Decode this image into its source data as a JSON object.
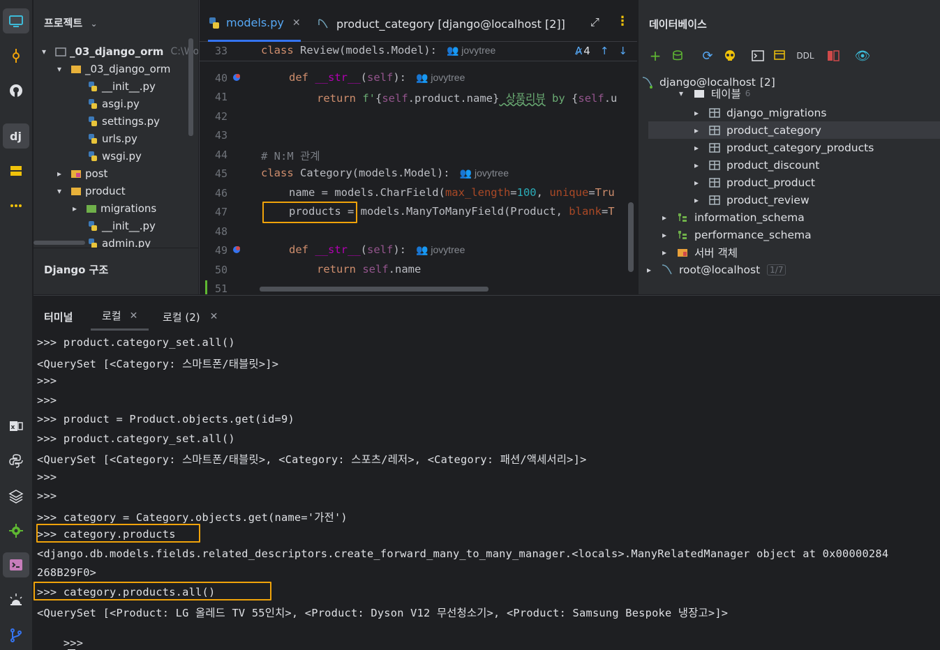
{
  "project_panel": {
    "title": "프로젝트",
    "tree": [
      {
        "label": "_03_django_orm",
        "suffix": "C:\\Wo",
        "type": "root-folder",
        "expanded": true
      },
      {
        "label": "_03_django_orm",
        "type": "package",
        "expanded": true
      },
      {
        "label": "__init__.py",
        "type": "python"
      },
      {
        "label": "asgi.py",
        "type": "python"
      },
      {
        "label": "settings.py",
        "type": "python"
      },
      {
        "label": "urls.py",
        "type": "python"
      },
      {
        "label": "wsgi.py",
        "type": "python"
      },
      {
        "label": "post",
        "type": "app",
        "expanded": false
      },
      {
        "label": "product",
        "type": "package",
        "expanded": true
      },
      {
        "label": "migrations",
        "type": "migrations",
        "expanded": false
      },
      {
        "label": "__init__.py",
        "type": "python"
      },
      {
        "label": "admin.py",
        "type": "python"
      }
    ],
    "django_structure_title": "Django 구조"
  },
  "editor": {
    "tabs": [
      {
        "label": "models.py",
        "active": true
      },
      {
        "label": "product_category [django@localhost [2]]",
        "active": false
      }
    ],
    "inspection_count": "4",
    "lines": [
      {
        "num": "33",
        "code": "class Review(models.Model):",
        "author": "jovytree"
      },
      {
        "num": "40",
        "code": "def __str__(self):",
        "author": "jovytree"
      },
      {
        "num": "41",
        "code": "return f'{self.product.name} 상품리뷰 by {self.u"
      },
      {
        "num": "42",
        "code": ""
      },
      {
        "num": "43",
        "code": ""
      },
      {
        "num": "44",
        "code": "# N:M 관계"
      },
      {
        "num": "45",
        "code": "class Category(models.Model):",
        "author": "jovytree"
      },
      {
        "num": "46",
        "code": "name = models.CharField(max_length=100, unique=Tru"
      },
      {
        "num": "47",
        "code": "products = models.ManyToManyField(Product, blank=T"
      },
      {
        "num": "48",
        "code": ""
      },
      {
        "num": "49",
        "code": "def __str__(self):",
        "author": "jovytree"
      },
      {
        "num": "50",
        "code": "return self.name"
      },
      {
        "num": "51",
        "code": ""
      }
    ]
  },
  "database_panel": {
    "title": "데이터베이스",
    "ddl_label": "DDL",
    "tree": [
      {
        "label": "django@localhost",
        "badge": "[2]",
        "type": "connection"
      },
      {
        "label": "테이블",
        "count": "6",
        "type": "folder"
      },
      {
        "label": "django_migrations",
        "type": "table"
      },
      {
        "label": "product_category",
        "type": "table",
        "selected": true
      },
      {
        "label": "product_category_products",
        "type": "table"
      },
      {
        "label": "product_discount",
        "type": "table"
      },
      {
        "label": "product_product",
        "type": "table"
      },
      {
        "label": "product_review",
        "type": "table"
      },
      {
        "label": "information_schema",
        "type": "schema"
      },
      {
        "label": "performance_schema",
        "type": "schema"
      },
      {
        "label": "서버 객체",
        "type": "server-objects"
      },
      {
        "label": "root@localhost",
        "badge": "1/7",
        "type": "connection"
      }
    ]
  },
  "terminal": {
    "tabs": [
      {
        "label": "터미널",
        "active": false
      },
      {
        "label": "로컬",
        "active": true
      },
      {
        "label": "로컬 (2)",
        "active": false
      }
    ],
    "lines": [
      ">>> product.category_set.all()",
      "<QuerySet [<Category: 스마트폰/태블릿>]>",
      ">>>",
      ">>>",
      ">>> product = Product.objects.get(id=9)",
      ">>> product.category_set.all()",
      "<QuerySet [<Category: 스마트폰/태블릿>, <Category: 스포츠/레저>, <Category: 패션/액세서리>]>",
      ">>>",
      ">>>",
      ">>> category = Category.objects.get(name='가전')",
      ">>> category.products",
      "<django.db.models.fields.related_descriptors.create_forward_many_to_many_manager.<locals>.ManyRelatedManager object at 0x00000284",
      "268B29F0>",
      ">>> category.products.all()",
      "<QuerySet [<Product: LG 올레드 TV 55인치>, <Product: Dyson V12 무선청소기>, <Product: Samsung Bespoke 냉장고>]>",
      ">>>"
    ]
  },
  "colors": {
    "highlight": "#f0a30a",
    "accent": "#3574f0"
  }
}
